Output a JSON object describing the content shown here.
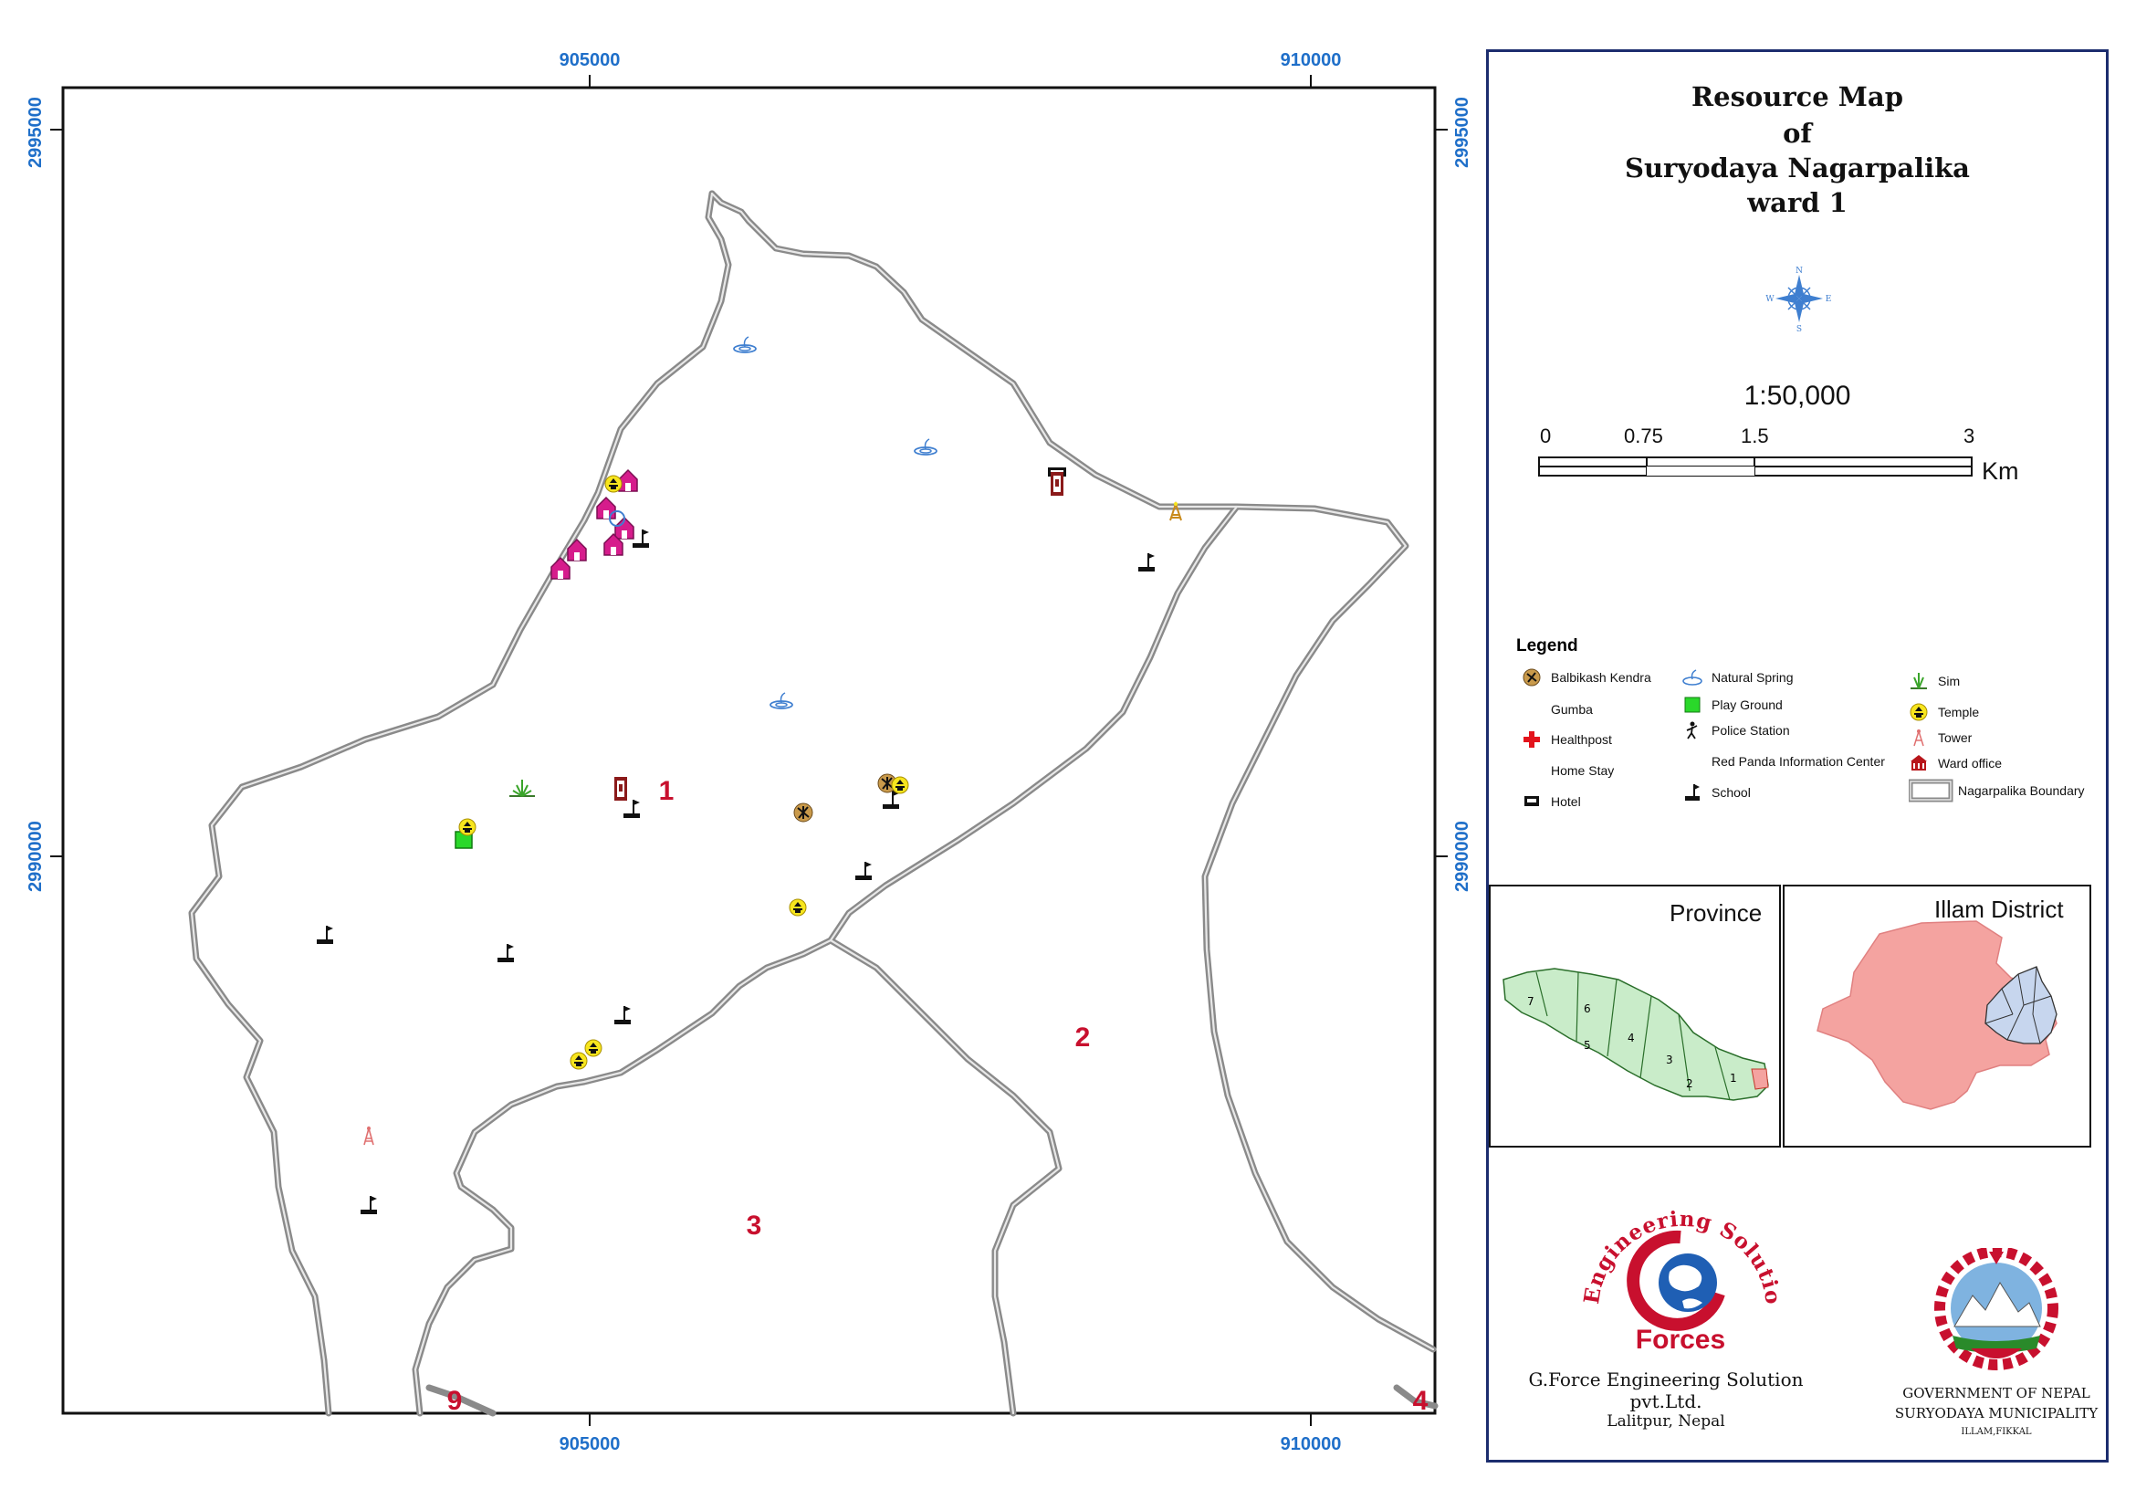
{
  "map": {
    "grid_labels": {
      "top": [
        "905000",
        "910000"
      ],
      "bottom": [
        "905000",
        "910000"
      ],
      "left": [
        "2995000",
        "2990000"
      ],
      "right": [
        "2995000",
        "2990000"
      ]
    },
    "ward_labels": [
      "1",
      "2",
      "3",
      "9",
      "4"
    ]
  },
  "panel": {
    "title": [
      "Resource Map",
      "of",
      "Suryodaya Nagarpalika",
      "ward 1"
    ],
    "north_arrow": {
      "n": "N",
      "s": "S",
      "e": "E",
      "w": "W"
    },
    "scale": {
      "ratio": "1:50,000",
      "ticks": [
        "0",
        "0.75",
        "1.5",
        "3"
      ],
      "unit": "Km"
    },
    "legend": {
      "title": "Legend",
      "items": [
        {
          "label": "Balbikash Kendra",
          "icon": "balbikash-icon"
        },
        {
          "label": "Gumba",
          "icon": "gumba-icon"
        },
        {
          "label": "Healthpost",
          "icon": "red-cross-icon"
        },
        {
          "label": "Home Stay",
          "icon": "home-stay-icon"
        },
        {
          "label": "Hotel",
          "icon": "hotel-icon"
        },
        {
          "label": "Natural Spring",
          "icon": "spring-icon"
        },
        {
          "label": "Play Ground",
          "icon": "playground-icon"
        },
        {
          "label": "Police Station",
          "icon": "police-icon"
        },
        {
          "label": "Red Panda Information Center",
          "icon": "red-panda-icon"
        },
        {
          "label": "School",
          "icon": "school-flag-icon"
        },
        {
          "label": "Sim",
          "icon": "sim-icon"
        },
        {
          "label": "Temple",
          "icon": "temple-icon"
        },
        {
          "label": "Tower",
          "icon": "tower-icon"
        },
        {
          "label": "Ward office",
          "icon": "ward-office-icon"
        },
        {
          "label": "Nagarpalika Boundary",
          "icon": "boundary-icon"
        }
      ]
    },
    "insets": {
      "province_label": "Province",
      "district_label": "Illam District",
      "province_numbers": [
        "7",
        "6",
        "5",
        "4",
        "3",
        "2",
        "1"
      ]
    },
    "company": {
      "logo_arc_text": "Engineering Solution Pvt. Ltd.",
      "logo_word": "Forces",
      "name": "G.Force Engineering Solution pvt.Ltd.",
      "location": "Lalitpur, Nepal"
    },
    "government": {
      "line1": "GOVERNMENT OF NEPAL",
      "line2": "SURYODAYA MUNICIPALITY",
      "line3": "ILLAM,FIKKAL"
    }
  },
  "colors": {
    "grid_label": "#1f6fc9",
    "ward_label": "#c8102e",
    "boundary": "#8a8a8a",
    "panel_border": "#1c2d6e",
    "province_fill": "#c9ecc9",
    "district_fill": "#f4a3a0"
  }
}
